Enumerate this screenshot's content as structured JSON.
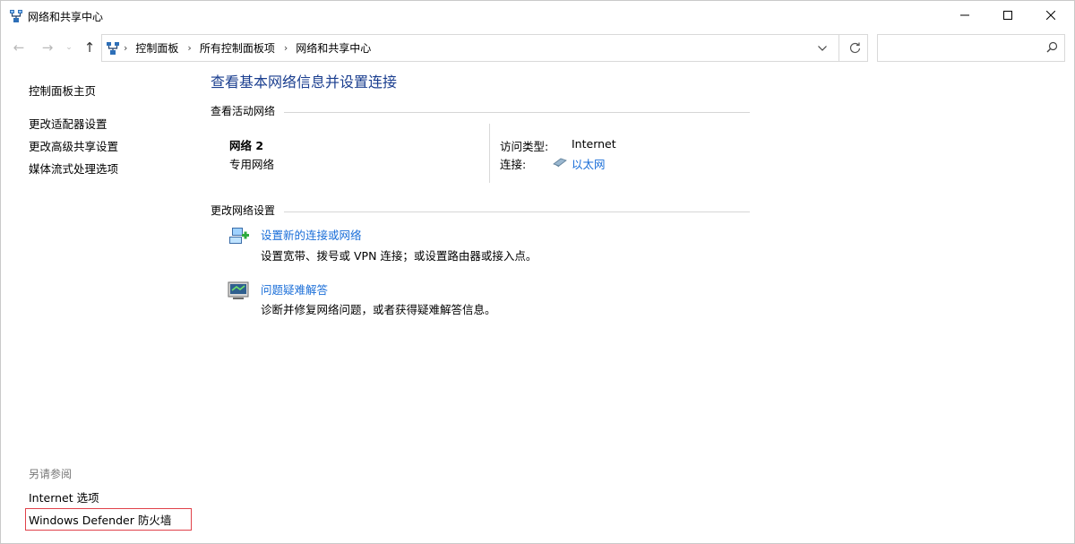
{
  "window": {
    "title": "网络和共享中心"
  },
  "address": {
    "crumbs": [
      "控制面板",
      "所有控制面板项",
      "网络和共享中心"
    ]
  },
  "search": {
    "placeholder": ""
  },
  "sidebar": {
    "items": [
      {
        "label": "控制面板主页"
      },
      {
        "label": "更改适配器设置"
      },
      {
        "label": "更改高级共享设置"
      },
      {
        "label": "媒体流式处理选项"
      }
    ],
    "see_also_heading": "另请参阅",
    "see_also": [
      {
        "label": "Internet 选项"
      },
      {
        "label": "Windows Defender 防火墙"
      }
    ]
  },
  "main": {
    "title": "查看基本网络信息并设置连接",
    "active_networks_heading": "查看活动网络",
    "network": {
      "name": "网络 2",
      "type": "专用网络",
      "access_type_label": "访问类型:",
      "access_type_value": "Internet",
      "connection_label": "连接:",
      "connection_value": "以太网"
    },
    "change_settings_heading": "更改网络设置",
    "tasks": [
      {
        "link": "设置新的连接或网络",
        "desc": "设置宽带、拨号或 VPN 连接；或设置路由器或接入点。",
        "icon": "new-connection-icon"
      },
      {
        "link": "问题疑难解答",
        "desc": "诊断并修复网络问题，或者获得疑难解答信息。",
        "icon": "troubleshoot-icon"
      }
    ]
  },
  "colors": {
    "title_blue": "#1a3e8f",
    "link_blue": "#1a6ed8",
    "highlight_red": "#e0424a"
  }
}
